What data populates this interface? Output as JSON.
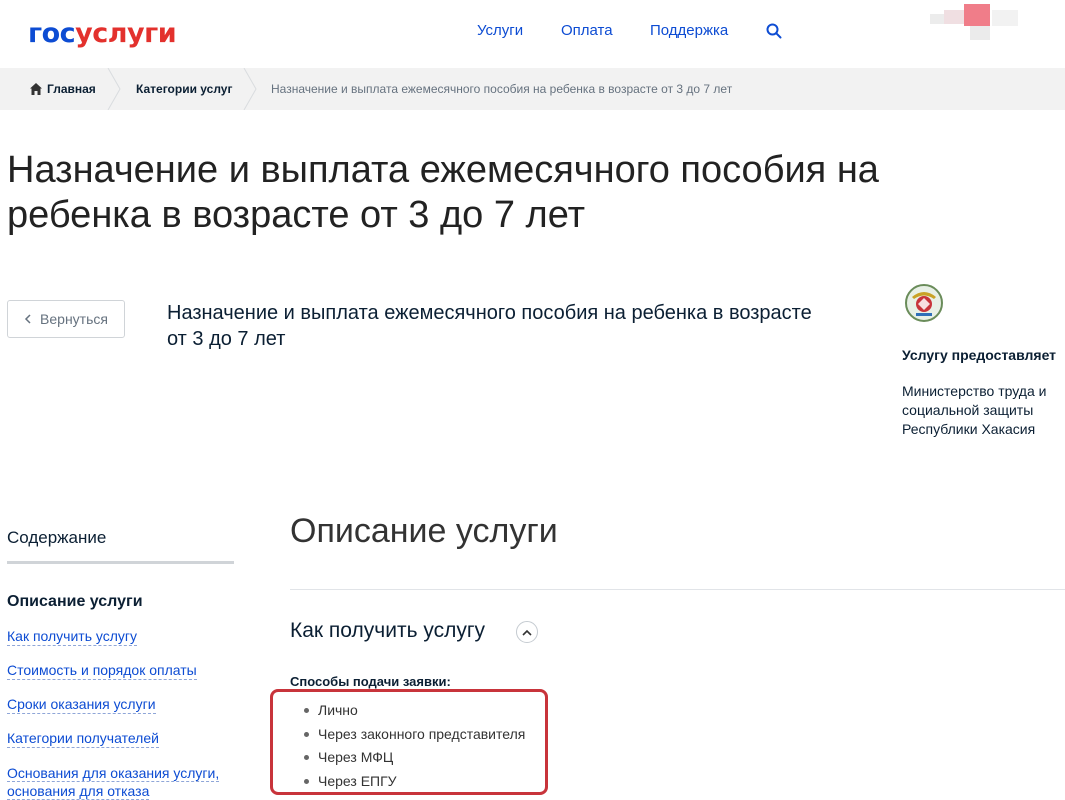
{
  "header": {
    "logo_part1": "гос",
    "logo_part2": "услуги",
    "nav": [
      "Услуги",
      "Оплата",
      "Поддержка"
    ]
  },
  "breadcrumbs": {
    "home": "Главная",
    "categories": "Категории услуг",
    "current": "Назначение и выплата ежемесячного пособия на ребенка в возрасте от 3 до 7 лет"
  },
  "page_title": "Назначение и выплата ежемесячного пособия на ребенка в возрасте от 3 до 7 лет",
  "back_label": "Вернуться",
  "service_title": "Назначение и выплата ежемесячного пособия на ребенка в возрасте от 3 до 7 лет",
  "provider": {
    "label": "Услугу предоставляет",
    "name": "Министерство труда и социальной защиты Республики Хакасия"
  },
  "toc": {
    "title": "Содержание",
    "active": "Описание услуги",
    "links": [
      "Как получить услугу",
      "Стоимость и порядок оплаты",
      "Сроки оказания услуги",
      "Категории получателей",
      "Основания для оказания услуги, основания для отказа"
    ]
  },
  "main": {
    "section_title": "Описание услуги",
    "sub_title": "Как получить услугу",
    "methods_label": "Способы подачи заявки:",
    "methods": [
      "Лично",
      "Через законного представителя",
      "Через МФЦ",
      "Через ЕПГУ"
    ]
  },
  "colors": {
    "brand_blue": "#0d4cd3",
    "brand_red": "#e3312d",
    "highlight_red": "#c8343b"
  }
}
